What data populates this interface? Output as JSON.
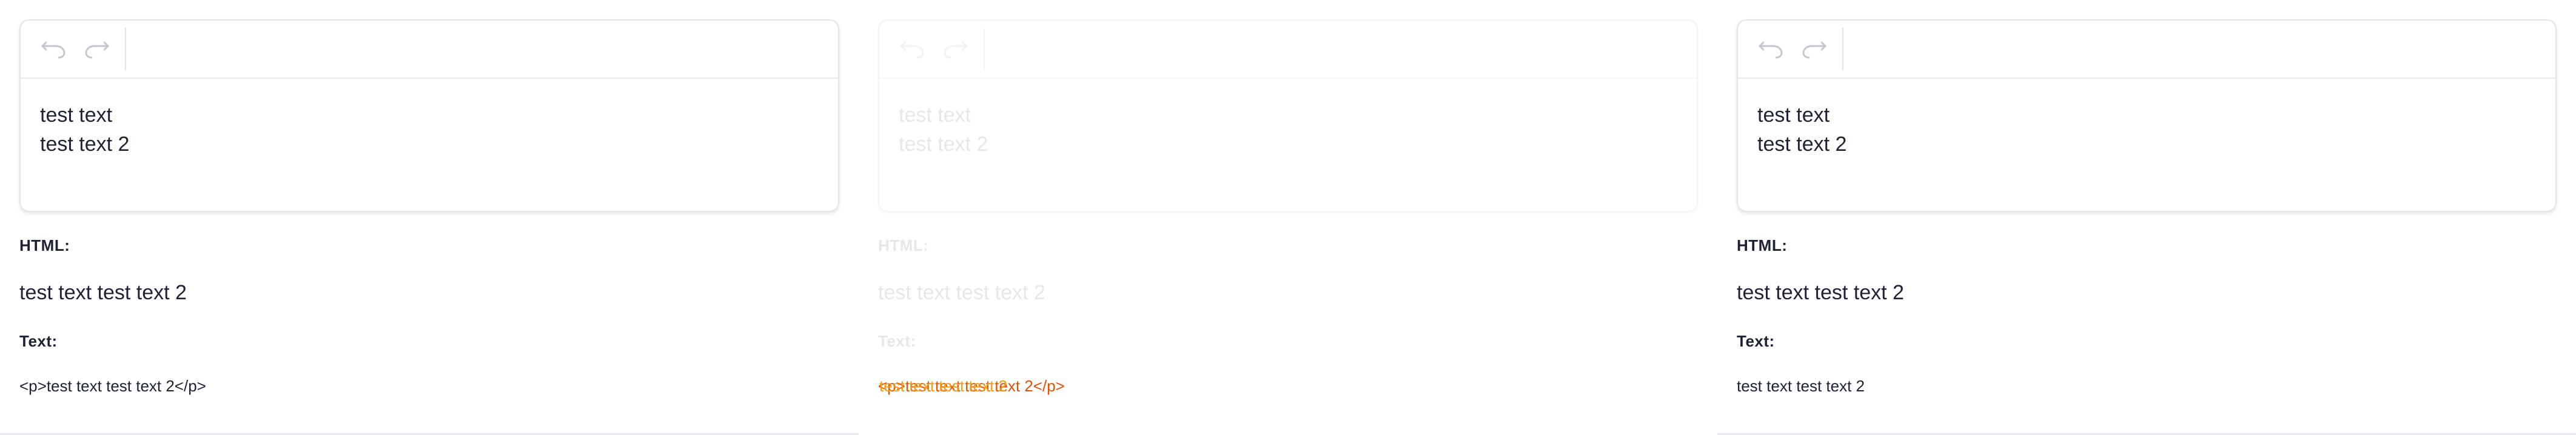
{
  "toolbar": {
    "undo_icon": "undo-icon",
    "redo_icon": "redo-icon"
  },
  "labels": {
    "html": "HTML:",
    "text": "Text:"
  },
  "panels": [
    {
      "state": "enabled",
      "content": {
        "line1": "test text",
        "line2": "test text 2"
      },
      "html_output": "test text test text 2",
      "text_output": "<p>test text test text 2</p>"
    },
    {
      "state": "disabled",
      "content": {
        "line1": "test text",
        "line2": "test text 2"
      },
      "html_output": "test text test text 2",
      "text_output_overlap": [
        "<p>test text test text 2</p>",
        "test text test text 2"
      ]
    },
    {
      "state": "enabled",
      "content": {
        "line1": "test text",
        "line2": "test text 2"
      },
      "html_output": "test text test text 2",
      "text_output": "test text test text 2"
    }
  ],
  "colors": {
    "text": "#1e2235",
    "border": "#e3e5eb",
    "icon": "#c4c7d0",
    "disabled_text": "#e6e7eb",
    "overlap_orange": "#e65100",
    "overlap_yellow": "#f39c12"
  }
}
